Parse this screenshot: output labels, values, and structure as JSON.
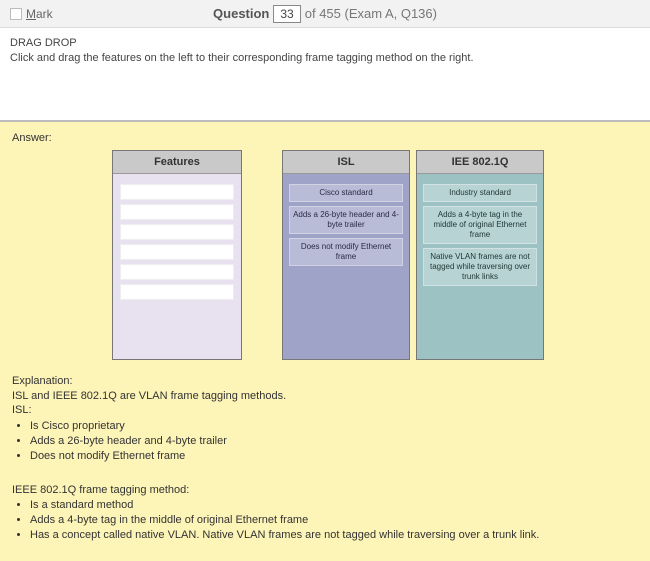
{
  "header": {
    "mark_label_pre": "M",
    "mark_label_post": "ark",
    "question_word": "Question",
    "question_number": "33",
    "question_total": "of 455 (Exam A, Q136)"
  },
  "instruction": {
    "title": "DRAG DROP",
    "body": "Click and drag the features on the left to their corresponding frame tagging method on the right."
  },
  "answer_label": "Answer:",
  "panels": {
    "features_title": "Features",
    "isl_title": "ISL",
    "ieee_title": "IEE 802.1Q",
    "isl_items": [
      "Cisco standard",
      "Adds a 26-byte header and 4-byte trailer",
      "Does not modify Ethernet frame"
    ],
    "ieee_items": [
      "Industry standard",
      "Adds a 4-byte tag in the middle of original Ethernet frame",
      "Native VLAN frames are not tagged while traversing over trunk links"
    ]
  },
  "explanation": {
    "heading": "Explanation:",
    "intro": "ISL and IEEE 802.1Q are VLAN frame tagging methods.",
    "isl_label": "ISL:",
    "isl_points": [
      "Is Cisco proprietary",
      "Adds a 26-byte header and 4-byte trailer",
      "Does not modify Ethernet frame"
    ],
    "ieee_label": "IEEE 802.1Q frame tagging method:",
    "ieee_points": [
      "Is a standard method",
      "Adds a 4-byte tag in the middle of original Ethernet frame",
      "Has a concept called native VLAN. Native VLAN frames are not tagged while traversing over a trunk link."
    ]
  }
}
